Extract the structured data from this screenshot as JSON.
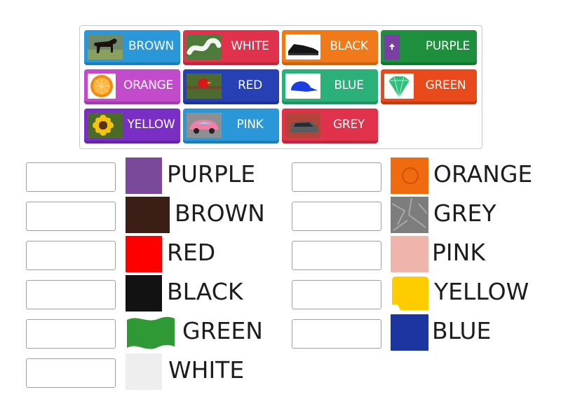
{
  "bank": {
    "tiles": [
      {
        "label": "BROWN",
        "color": "#2a97d8",
        "image": "horse-photo"
      },
      {
        "label": "WHITE",
        "color": "#e0324b",
        "image": "white-snake-photo"
      },
      {
        "label": "BLACK",
        "color": "#f07a19",
        "image": "black-sneaker-photo"
      },
      {
        "label": "PURPLE",
        "color": "#1e8f3c",
        "image": "purple-swatch"
      },
      {
        "label": "ORANGE",
        "color": "#c24bcc",
        "image": "orange-fruit-photo"
      },
      {
        "label": "RED",
        "color": "#2740b3",
        "image": "red-bird-photo"
      },
      {
        "label": "BLUE",
        "color": "#2bb07a",
        "image": "blue-cap-photo"
      },
      {
        "label": "GREEN",
        "color": "#e84a1c",
        "image": "green-gem-photo"
      },
      {
        "label": "YELLOW",
        "color": "#7a2fc4",
        "image": "sunflower-photo"
      },
      {
        "label": "PINK",
        "color": "#2a97d8",
        "image": "pink-car-photo"
      },
      {
        "label": "GREY",
        "color": "#e0324b",
        "image": "grey-car-photo"
      }
    ]
  },
  "targets": {
    "left": [
      {
        "word": "PURPLE",
        "swatch": "#7a4a9a"
      },
      {
        "word": "BROWN",
        "swatch": "#3b1f16"
      },
      {
        "word": "RED",
        "swatch": "#ff0000"
      },
      {
        "word": "BLACK",
        "swatch": "#121212"
      },
      {
        "word": "GREEN",
        "swatch": "#2f9a35"
      },
      {
        "word": "WHITE",
        "swatch": "#efefef"
      }
    ],
    "right": [
      {
        "word": "ORANGE",
        "swatch": "#f06a10"
      },
      {
        "word": "GREY",
        "swatch": "#7d7d7d"
      },
      {
        "word": "PINK",
        "swatch": "#efb4ab"
      },
      {
        "word": "YELLOW",
        "swatch": "#ffcc00"
      },
      {
        "word": "BLUE",
        "swatch": "#1d35a0"
      }
    ]
  }
}
